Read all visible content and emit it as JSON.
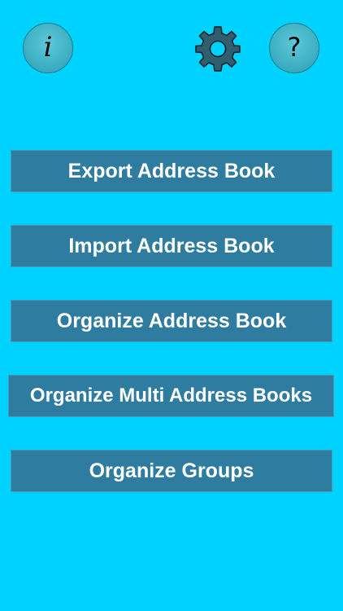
{
  "header": {
    "info_icon": "info-icon",
    "info_glyph": "i",
    "settings_icon": "gear-icon",
    "help_icon": "question-icon",
    "help_glyph": "?"
  },
  "menu": {
    "export_label": "Export Address Book",
    "import_label": "Import Address Book",
    "organize_label": "Organize Address Book",
    "organize_multi_label": "Organize Multi Address Books",
    "organize_groups_label": "Organize Groups"
  },
  "colors": {
    "background": "#00d2ff",
    "button_fill": "#2e7ca0",
    "icon_fill": "#3fb0c4",
    "text": "#ffffff"
  }
}
